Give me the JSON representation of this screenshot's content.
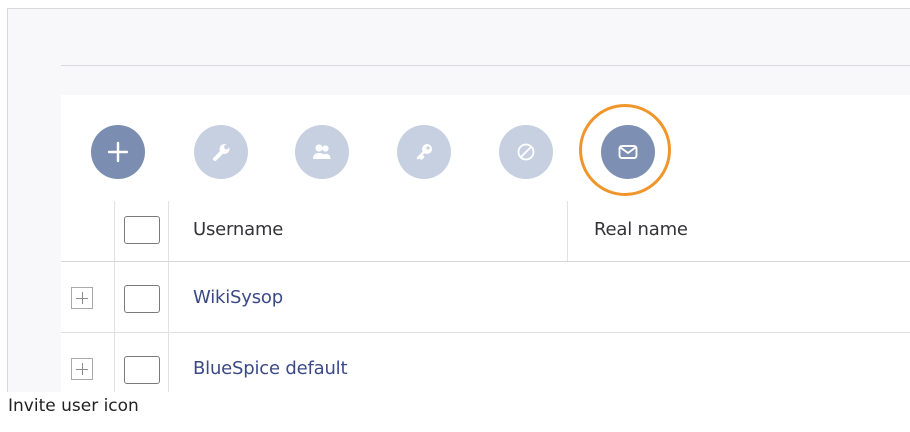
{
  "toolbar": {
    "buttons": [
      {
        "name": "add",
        "icon": "plus-icon",
        "color": "#7b8db0"
      },
      {
        "name": "edit",
        "icon": "wrench-icon",
        "color": "#c7d0e0"
      },
      {
        "name": "groups",
        "icon": "users-icon",
        "color": "#c7d0e0"
      },
      {
        "name": "password",
        "icon": "key-icon",
        "color": "#c7d0e0"
      },
      {
        "name": "disable",
        "icon": "block-icon",
        "color": "#c7d0e0"
      },
      {
        "name": "invite",
        "icon": "envelope-icon",
        "color": "#7d8fb2",
        "highlighted": true
      }
    ],
    "highlight_color": "#f0952a"
  },
  "grid": {
    "columns": {
      "username": "Username",
      "real_name": "Real name"
    },
    "rows": [
      {
        "username": "WikiSysop",
        "real_name": ""
      },
      {
        "username": "BlueSpice default",
        "real_name": ""
      }
    ]
  },
  "caption": "Invite user icon"
}
